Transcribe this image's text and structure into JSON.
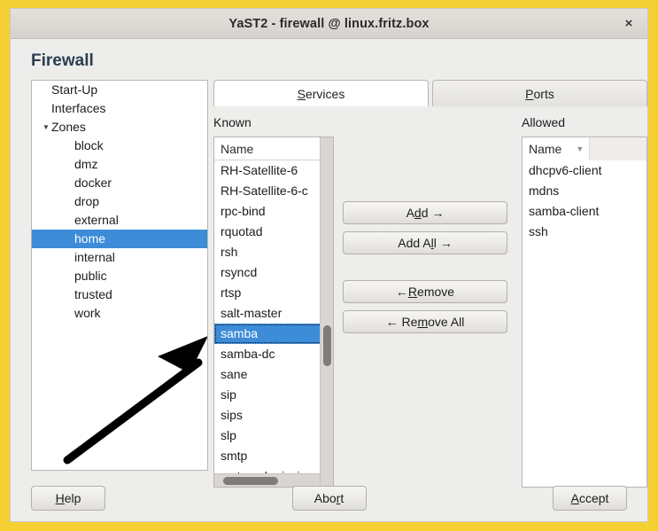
{
  "window": {
    "title": "YaST2 - firewall @ linux.fritz.box",
    "close_icon": "×",
    "page_title": "Firewall",
    "border_color": "#F5D033",
    "accent_color": "#3C8CD8"
  },
  "sidebar": {
    "items": [
      {
        "label": "Start-Up",
        "level": 0,
        "expander": "",
        "selected": false
      },
      {
        "label": "Interfaces",
        "level": 0,
        "expander": "",
        "selected": false
      },
      {
        "label": "Zones",
        "level": 0,
        "expander": "▼",
        "selected": false
      },
      {
        "label": "block",
        "level": 1,
        "expander": "",
        "selected": false
      },
      {
        "label": "dmz",
        "level": 1,
        "expander": "",
        "selected": false
      },
      {
        "label": "docker",
        "level": 1,
        "expander": "",
        "selected": false
      },
      {
        "label": "drop",
        "level": 1,
        "expander": "",
        "selected": false
      },
      {
        "label": "external",
        "level": 1,
        "expander": "",
        "selected": false
      },
      {
        "label": "home",
        "level": 1,
        "expander": "",
        "selected": true
      },
      {
        "label": "internal",
        "level": 1,
        "expander": "",
        "selected": false
      },
      {
        "label": "public",
        "level": 1,
        "expander": "",
        "selected": false
      },
      {
        "label": "trusted",
        "level": 1,
        "expander": "",
        "selected": false
      },
      {
        "label": "work",
        "level": 1,
        "expander": "",
        "selected": false
      }
    ]
  },
  "tabs": [
    {
      "label_pre": "",
      "label_mn": "S",
      "label_post": "ervices",
      "active": true
    },
    {
      "label_pre": "",
      "label_mn": "P",
      "label_post": "orts",
      "active": false
    }
  ],
  "known": {
    "label": "Known",
    "column_header": "Name",
    "items": [
      {
        "label": "RH-Satellite-6",
        "selected": false
      },
      {
        "label": "RH-Satellite-6-c",
        "selected": false
      },
      {
        "label": "rpc-bind",
        "selected": false
      },
      {
        "label": "rquotad",
        "selected": false
      },
      {
        "label": "rsh",
        "selected": false
      },
      {
        "label": "rsyncd",
        "selected": false
      },
      {
        "label": "rtsp",
        "selected": false
      },
      {
        "label": "salt-master",
        "selected": false
      },
      {
        "label": "samba",
        "selected": true
      },
      {
        "label": "samba-dc",
        "selected": false
      },
      {
        "label": "sane",
        "selected": false
      },
      {
        "label": "sip",
        "selected": false
      },
      {
        "label": "sips",
        "selected": false
      },
      {
        "label": "slp",
        "selected": false
      },
      {
        "label": "smtp",
        "selected": false
      },
      {
        "label": "smtp-submission",
        "selected": false
      }
    ]
  },
  "allowed": {
    "label": "Allowed",
    "column_header": "Name",
    "sort_icon": "▼",
    "items": [
      {
        "label": "dhcpv6-client"
      },
      {
        "label": "mdns"
      },
      {
        "label": "samba-client"
      },
      {
        "label": "ssh"
      }
    ]
  },
  "transfer_buttons": [
    {
      "pre": "A",
      "mn": "d",
      "post": "d →"
    },
    {
      "pre": "Add A",
      "mn": "l",
      "post": "l →"
    },
    {
      "pre": "← ",
      "mn": "R",
      "post": "emove"
    },
    {
      "pre": "← Re",
      "mn": "m",
      "post": "ove All"
    }
  ],
  "footer": {
    "help": {
      "pre": "",
      "mn": "H",
      "post": "elp"
    },
    "abort": {
      "pre": "Abo",
      "mn": "r",
      "post": "t"
    },
    "accept": {
      "pre": "",
      "mn": "A",
      "post": "ccept"
    }
  },
  "annotation": {
    "type": "arrow",
    "description": "black arrow pointing to samba entry",
    "color": "#000000"
  }
}
